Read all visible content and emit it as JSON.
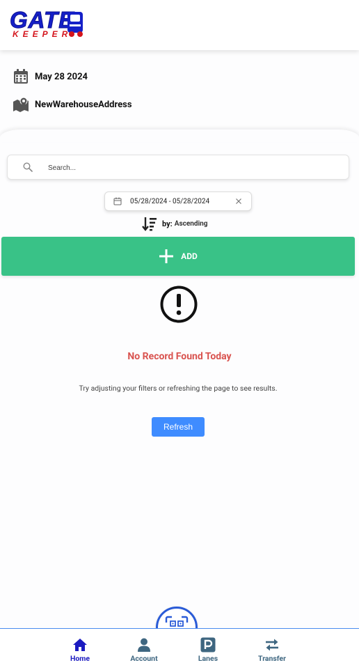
{
  "header": {
    "logo_text_top": "GATE",
    "logo_text_bottom": "KEEPER"
  },
  "info": {
    "date": "May 28 2024",
    "address": "NewWarehouseAddress"
  },
  "search": {
    "placeholder": "Search..."
  },
  "date_range": {
    "value": "05/28/2024 - 05/28/2024"
  },
  "sort": {
    "label": "by:",
    "value": "Ascending"
  },
  "add_button": {
    "label": "ADD"
  },
  "empty_state": {
    "title": "No Record Found Today",
    "subtitle": "Try adjusting your filters or refreshing the page to see results.",
    "refresh_label": "Refresh"
  },
  "bottom_nav": {
    "items": [
      {
        "label": "Home",
        "icon": "home-icon"
      },
      {
        "label": "Account",
        "icon": "user-icon"
      },
      {
        "label": "Lanes",
        "icon": "parking-icon"
      },
      {
        "label": "Transfer",
        "icon": "transfer-arrows-icon"
      }
    ],
    "scan_icon": "qr-scan-icon"
  },
  "colors": {
    "accent": "#39c287",
    "primary": "#3f8cff",
    "error": "#d9534f",
    "nav_active": "#1b1ac0",
    "nav_inactive": "#3e6680",
    "logo_blue": "#1520c8",
    "logo_red": "#d4141c"
  }
}
